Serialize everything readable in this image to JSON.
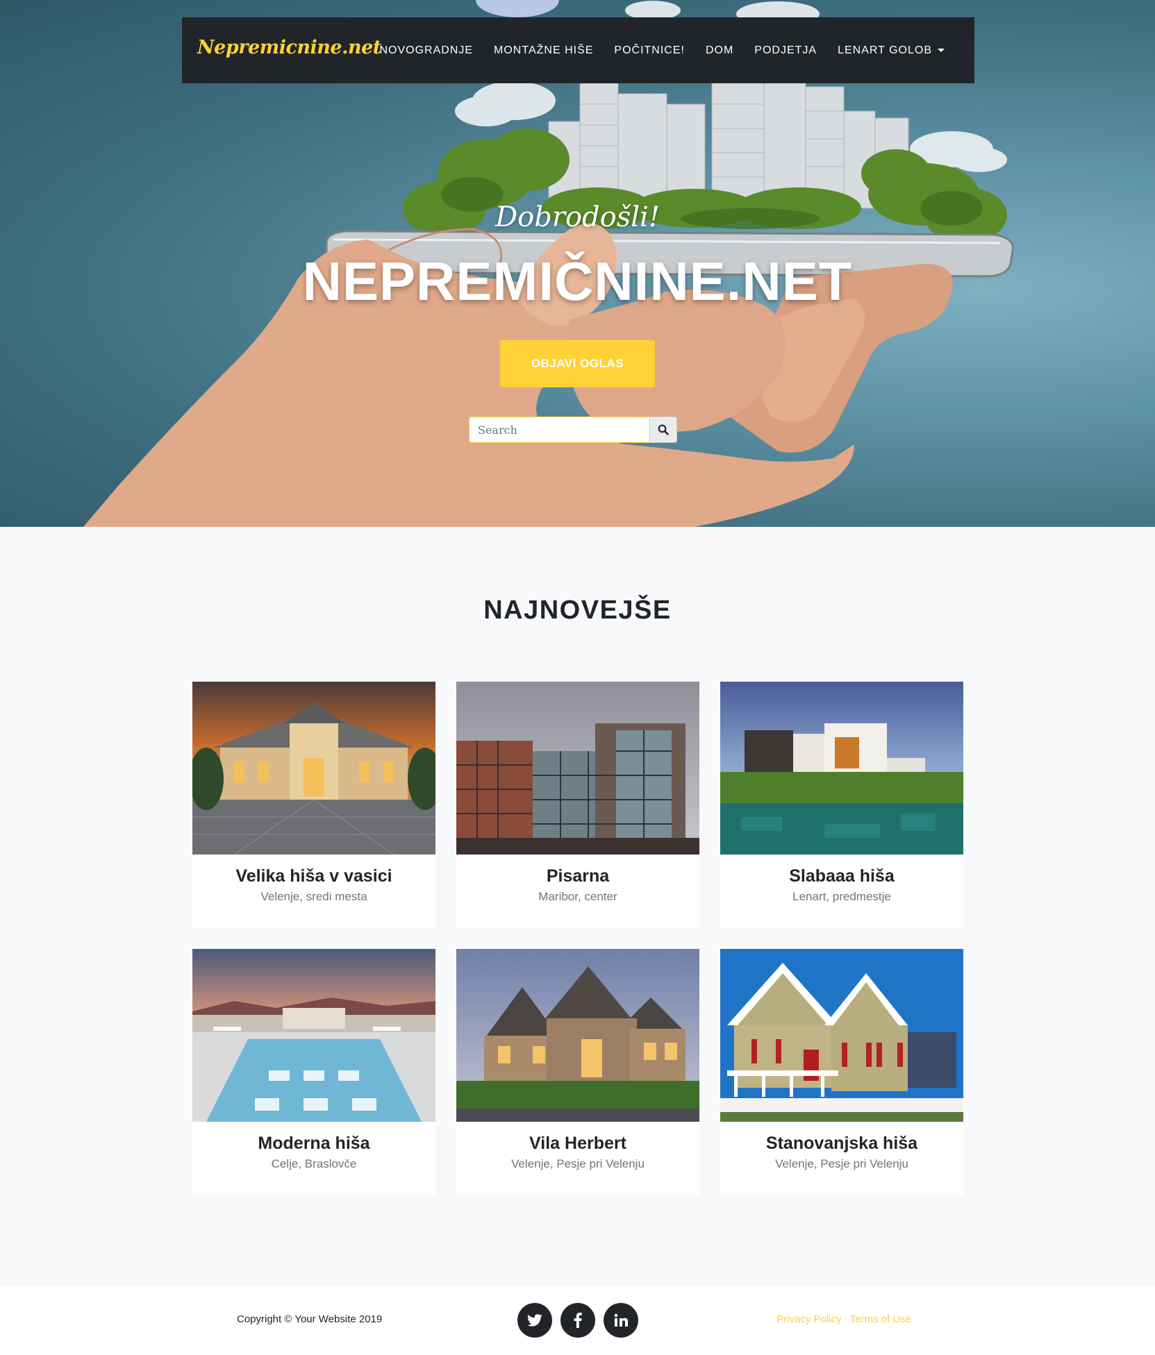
{
  "nav": {
    "brand": "Nepremicnine.net",
    "items": [
      "Novogradnje",
      "Montažne hiše",
      "Počitnice!",
      "Dom",
      "Podjetja",
      "Lenart Golob"
    ]
  },
  "hero": {
    "lead_in": "Dobrodošli!",
    "heading": "NEPREMIČNINE.NET",
    "button": "OBJAVI OGLAS",
    "search_placeholder": "Search"
  },
  "section": {
    "title": "NAJNOVEJŠE",
    "listings": [
      {
        "title": "Velika hiša v vasici",
        "location": "Velenje, sredi mesta"
      },
      {
        "title": "Pisarna",
        "location": "Maribor, center"
      },
      {
        "title": "Slabaaa hiša",
        "location": "Lenart, predmestje"
      },
      {
        "title": "Moderna hiša",
        "location": "Celje, Braslovče"
      },
      {
        "title": "Vila Herbert",
        "location": "Velenje, Pesje pri Velenju"
      },
      {
        "title": "Stanovanjska hiša",
        "location": "Velenje, Pesje pri Velenju"
      }
    ]
  },
  "footer": {
    "copyright": "Copyright © Your Website 2019",
    "social": [
      "twitter-icon",
      "facebook-icon",
      "linkedin-icon"
    ],
    "links": [
      "Privacy Policy",
      "Terms of Use"
    ]
  },
  "colors": {
    "accent": "#fed136",
    "dark": "#212529",
    "muted": "#6c757d"
  }
}
